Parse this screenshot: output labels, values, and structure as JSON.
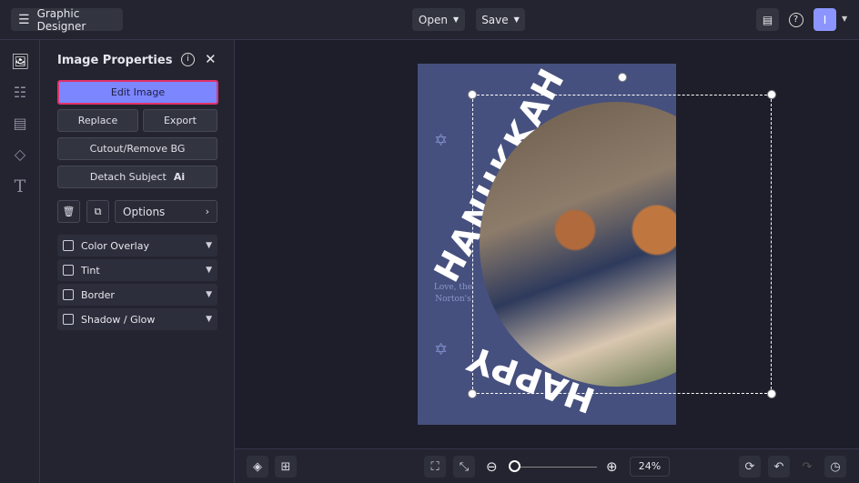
{
  "topbar": {
    "app_title": "Graphic Designer",
    "open_label": "Open",
    "save_label": "Save",
    "avatar_initial": "I"
  },
  "panel": {
    "title": "Image Properties",
    "edit_image": "Edit Image",
    "replace": "Replace",
    "export": "Export",
    "cutout": "Cutout/Remove BG",
    "detach": "Detach Subject",
    "ai_badge": "Ai",
    "options": "Options",
    "sections": [
      "Color Overlay",
      "Tint",
      "Border",
      "Shadow / Glow"
    ]
  },
  "canvas": {
    "headline_top": "HANUKKAH",
    "headline_bottom": "HAPPY",
    "signature": "Love, the Norton's"
  },
  "bottombar": {
    "zoom_level": "24%",
    "zoom_fraction": 0.05
  },
  "colors": {
    "accent": "#7b86ff",
    "highlight_border": "#e0336b",
    "poster": "#46507e"
  }
}
